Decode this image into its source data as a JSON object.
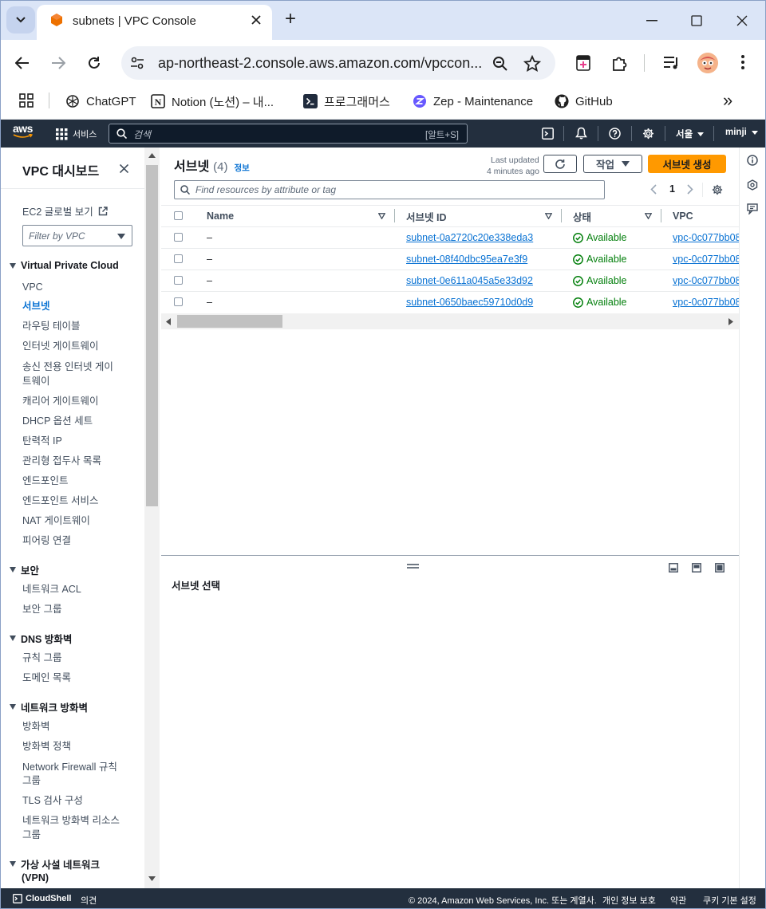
{
  "browser": {
    "tab_title": "subnets | VPC Console",
    "url": "ap-northeast-2.console.aws.amazon.com/vpccon...",
    "new_tab_symbol": "+",
    "bookmarks": [
      "ChatGPT",
      "Notion (노션) – 내...",
      "프로그래머스",
      "Zep - Maintenance",
      "GitHub"
    ],
    "more_bookmarks": "»"
  },
  "aws_nav": {
    "logo": "aws",
    "services": "서비스",
    "search_placeholder": "검색",
    "search_shortcut": "[알트+S]",
    "region": "서울",
    "user": "minji"
  },
  "sidebar": {
    "title": "VPC 대시보드",
    "ec2_global": "EC2 글로벌 보기",
    "filter_placeholder": "Filter by VPC",
    "sections": [
      {
        "header": "Virtual Private Cloud",
        "items": [
          "VPC",
          "서브넷",
          "라우팅 테이블",
          "인터넷 게이트웨이",
          "송신 전용 인터넷 게이",
          "트웨이",
          "캐리어 게이트웨이",
          "DHCP 옵션 세트",
          "탄력적 IP",
          "관리형 접두사 목록",
          "엔드포인트",
          "엔드포인트 서비스",
          "NAT 게이트웨이",
          "피어링 연결"
        ]
      },
      {
        "header": "보안",
        "items": [
          "네트워크 ACL",
          "보안 그룹"
        ]
      },
      {
        "header": "DNS 방화벽",
        "items": [
          "규칙 그룹",
          "도메인 목록"
        ]
      },
      {
        "header": "네트워크 방화벽",
        "items": [
          "방화벽",
          "방화벽 정책",
          "Network Firewall 규칙",
          "그룹",
          "TLS 검사 구성",
          "네트워크 방화벽 리소스",
          "그룹"
        ]
      },
      {
        "header": "가상 사설 네트워크",
        "header2": "(VPN)"
      }
    ]
  },
  "main": {
    "title": "서브넷",
    "count": "(4)",
    "info": "정보",
    "last_updated_label": "Last updated",
    "last_updated_value": "4 minutes ago",
    "actions": "작업",
    "create": "서브넷 생성",
    "search_placeholder": "Find resources by attribute or tag",
    "page": "1",
    "columns": [
      "Name",
      "서브넷 ID",
      "상태",
      "VPC"
    ],
    "rows": [
      {
        "name": "–",
        "subnet_id": "subnet-0a2720c20e338eda3",
        "state": "Available",
        "vpc": "vpc-0c077bb08"
      },
      {
        "name": "–",
        "subnet_id": "subnet-08f40dbc95ea7e3f9",
        "state": "Available",
        "vpc": "vpc-0c077bb08"
      },
      {
        "name": "–",
        "subnet_id": "subnet-0e611a045a5e33d92",
        "state": "Available",
        "vpc": "vpc-0c077bb08"
      },
      {
        "name": "–",
        "subnet_id": "subnet-0650baec59710d0d9",
        "state": "Available",
        "vpc": "vpc-0c077bb08"
      }
    ],
    "split_panel_title": "서브넷 선택"
  },
  "footer": {
    "cloudshell": "CloudShell",
    "feedback": "의견",
    "copyright": "© 2024, Amazon Web Services, Inc. 또는 계열사.",
    "privacy": "개인 정보 보호",
    "terms": "약관",
    "cookies": "쿠키 기본 설정"
  },
  "colors": {
    "aws_nav": "#232f3e",
    "primary_button": "#ff9900",
    "link": "#0972d3",
    "success": "#037f0c",
    "chrome_tabbar": "#dbe5f7"
  }
}
